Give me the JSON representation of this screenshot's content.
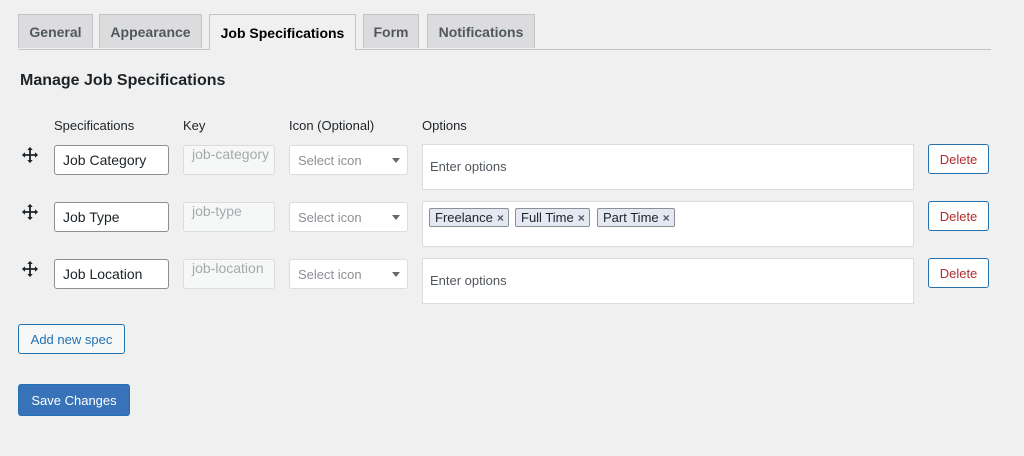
{
  "tabs": [
    {
      "label": "General",
      "active": false
    },
    {
      "label": "Appearance",
      "active": false
    },
    {
      "label": "Job Specifications",
      "active": true
    },
    {
      "label": "Form",
      "active": false
    },
    {
      "label": "Notifications",
      "active": false
    }
  ],
  "section": {
    "title": "Manage Job Specifications"
  },
  "columns": {
    "specifications": "Specifications",
    "key": "Key",
    "icon": "Icon (Optional)",
    "options": "Options"
  },
  "specs": [
    {
      "name": "Job Category",
      "key": "job-category",
      "icon_placeholder": "Select icon",
      "options_placeholder": "Enter options",
      "options": [],
      "delete_label": "Delete"
    },
    {
      "name": "Job Type",
      "key": "job-type",
      "icon_placeholder": "Select icon",
      "options_placeholder": "",
      "options": [
        "Freelance",
        "Full Time",
        "Part Time"
      ],
      "delete_label": "Delete"
    },
    {
      "name": "Job Location",
      "key": "job-location",
      "icon_placeholder": "Select icon",
      "options_placeholder": "Enter options",
      "options": [],
      "delete_label": "Delete"
    }
  ],
  "chip_remove_glyph": "×",
  "buttons": {
    "add_spec": "Add new spec",
    "save": "Save Changes"
  },
  "icons": {
    "drag": "move-arrows-icon",
    "remove": "close-icon",
    "dropdown": "caret-down-icon"
  },
  "colors": {
    "accent": "#2271b1",
    "primary_button": "#3872b8",
    "danger": "#b32d2e",
    "background": "#f0f0f1"
  }
}
